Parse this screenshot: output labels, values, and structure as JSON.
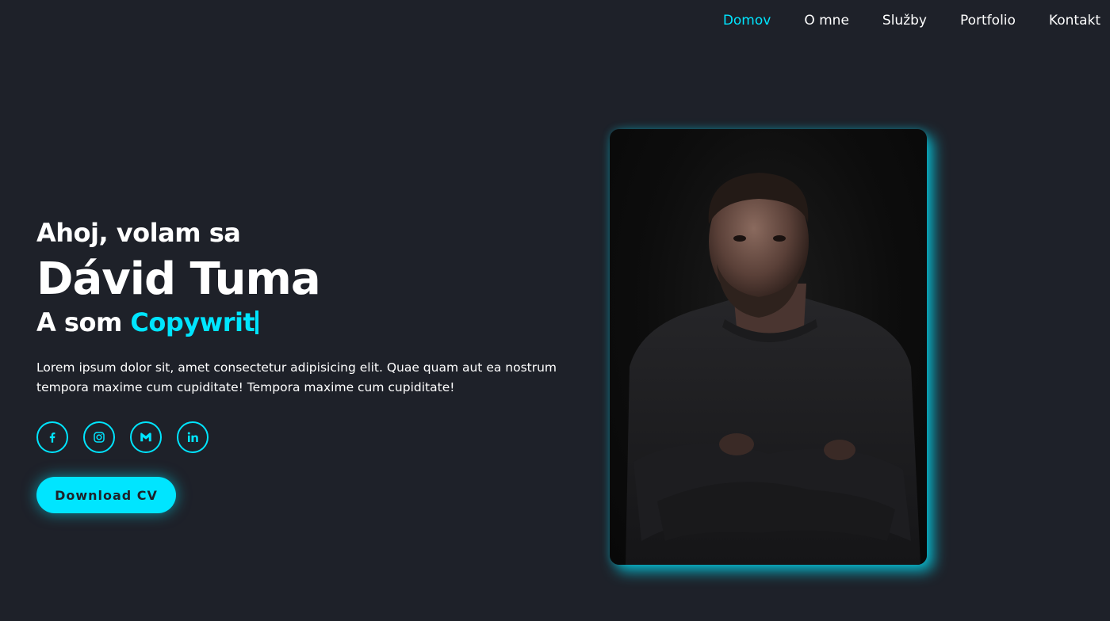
{
  "nav": {
    "items": [
      {
        "label": "Domov",
        "active": true
      },
      {
        "label": "O mne",
        "active": false
      },
      {
        "label": "Služby",
        "active": false
      },
      {
        "label": "Portfolio",
        "active": false
      },
      {
        "label": "Kontakt",
        "active": false
      }
    ]
  },
  "hero": {
    "greeting": "Ahoj, volam sa",
    "name": "Dávid Tuma",
    "role_prefix": "A som",
    "role_typed": "Copywrit",
    "description": "Lorem ipsum dolor sit, amet consectetur adipisicing elit. Quae quam aut ea nostrum tempora maxime cum cupiditate! Tempora maxime cum cupiditate!",
    "cv_button": "Download CV"
  },
  "socials": [
    {
      "icon": "facebook-icon"
    },
    {
      "icon": "instagram-icon"
    },
    {
      "icon": "gmail-icon"
    },
    {
      "icon": "linkedin-icon"
    }
  ],
  "colors": {
    "background": "#1e2129",
    "accent": "#00e5ff",
    "text": "#ffffff"
  }
}
